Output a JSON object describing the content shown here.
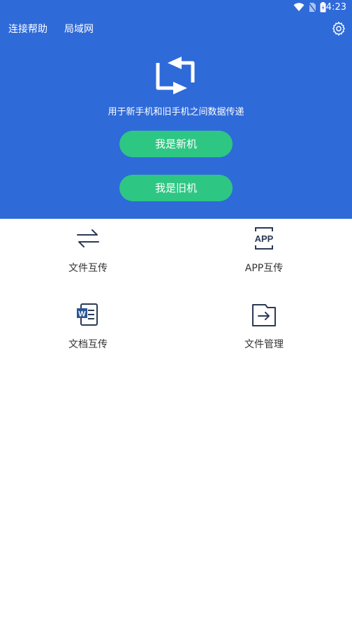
{
  "status_bar": {
    "time": "4:23",
    "icons": [
      "wifi-icon",
      "no-sim-icon",
      "battery-icon"
    ]
  },
  "header": {
    "link_help": "连接帮助",
    "link_lan": "局域网",
    "settings_icon": "gear-icon"
  },
  "hero": {
    "logo_icon": "transfer-swap-icon",
    "subtitle": "用于新手机和旧手机之间数据传递",
    "btn_new": "我是新机",
    "btn_old": "我是旧机"
  },
  "tools": [
    {
      "label": "文件互传",
      "icon": "arrows-exchange-icon"
    },
    {
      "label": "APP互传",
      "icon": "app-transfer-icon"
    },
    {
      "label": "文档互传",
      "icon": "word-document-icon"
    },
    {
      "label": "文件管理",
      "icon": "folder-arrow-icon"
    }
  ],
  "colors": {
    "primary": "#2f6ad9",
    "button": "#2ec683",
    "icon": "#2b3a55",
    "word_blue": "#2b5797"
  }
}
